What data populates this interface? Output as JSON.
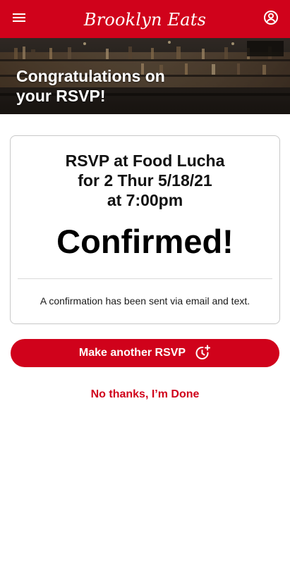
{
  "header": {
    "brand": "Brooklyn Eats",
    "menu_icon": "hamburger-menu-icon",
    "account_icon": "account-circle-icon",
    "background_color": "#d0021b"
  },
  "hero": {
    "title": "Congratulations on your RSVP!"
  },
  "confirmation": {
    "line1": "RSVP at Food Lucha",
    "line2": "for 2 Thur 5/18/21",
    "line3": "at 7:00pm",
    "status": "Confirmed!",
    "note": "A confirmation has been sent via email and text."
  },
  "actions": {
    "primary_label": "Make another RSVP",
    "primary_icon": "add-time-icon",
    "secondary_label": "No thanks, I’m Done"
  },
  "colors": {
    "accent": "#d0021b",
    "card_border": "#c8c8c8",
    "text": "#111111"
  }
}
